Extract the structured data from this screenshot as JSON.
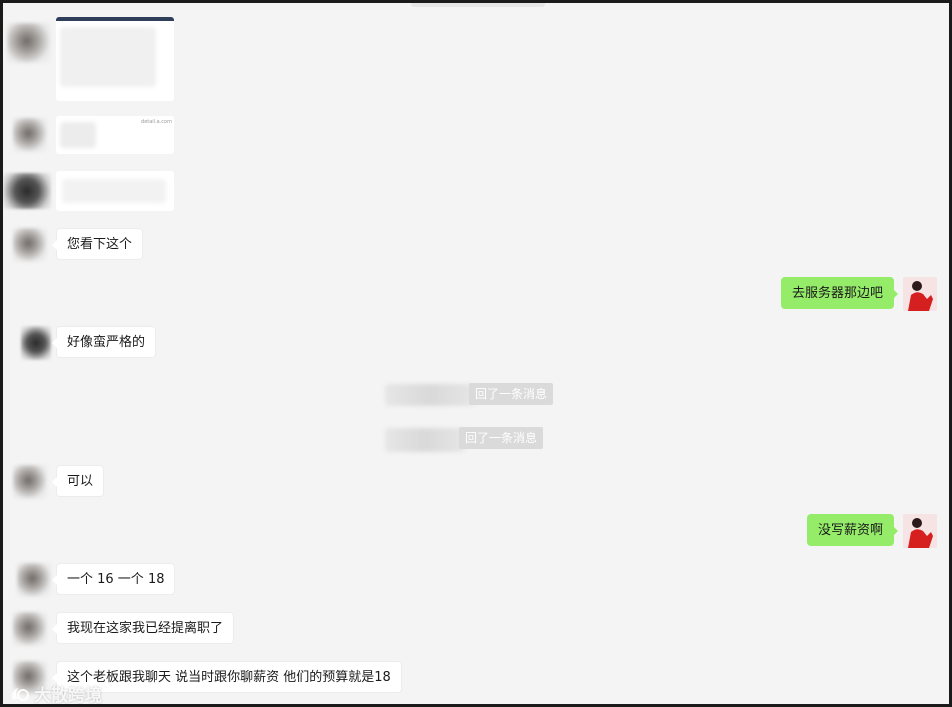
{
  "messages": [
    {
      "side": "in",
      "text": "您看下这个"
    },
    {
      "side": "out",
      "text": "去服务器那边吧"
    },
    {
      "side": "in",
      "text": "好像蛮严格的"
    },
    {
      "side": "in",
      "text": "可以"
    },
    {
      "side": "out",
      "text": "没写薪资啊"
    },
    {
      "side": "in",
      "text": "一个 16 一个 18"
    },
    {
      "side": "in",
      "text": "我现在这家我已经提离职了"
    },
    {
      "side": "in",
      "text": "这个老板跟我聊天 说当时跟你聊薪资 他们的预算就是18"
    }
  ],
  "system_notices": [
    {
      "text": "回了一条消息"
    },
    {
      "text": "回了一条消息"
    }
  ],
  "image_hint": "detail.a.com",
  "watermark": "大散跨境",
  "colors": {
    "outgoing": "#95ec69",
    "incoming": "#ffffff",
    "background": "#f4f4f4",
    "system": "#dadada"
  }
}
